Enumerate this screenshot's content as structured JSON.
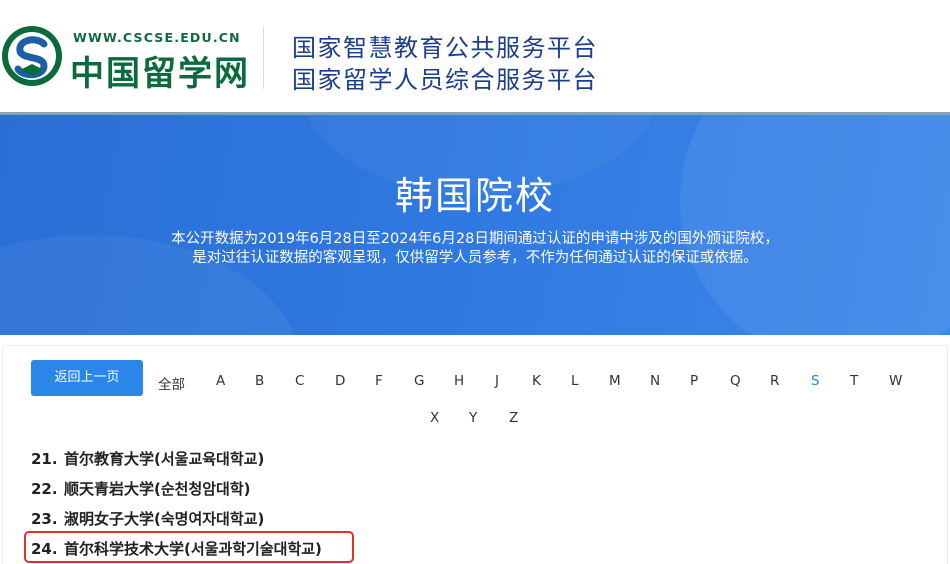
{
  "header": {
    "logo_url": "WWW.CSCSE.EDU.CN",
    "logo_name": "中国留学网",
    "platform_line1": "国家智慧教育公共服务平台",
    "platform_line2": "国家留学人员综合服务平台"
  },
  "banner": {
    "title": "韩国院校",
    "description_line1": "本公开数据为2019年6月28日至2024年6月28日期间通过认证的申请中涉及的国外颁证院校，",
    "description_line2": "是对过往认证数据的客观呈现，仅供留学人员参考，不作为任何通过认证的保证或依据。"
  },
  "filter": {
    "back_label": "返回上一页",
    "all_label": "全部",
    "letters_row1": [
      "A",
      "B",
      "C",
      "D",
      "F",
      "G",
      "H",
      "J",
      "K",
      "L",
      "M",
      "N",
      "P",
      "Q",
      "R",
      "S",
      "T",
      "W"
    ],
    "letters_row2": [
      "X",
      "Y",
      "Z"
    ],
    "active_letter": "S"
  },
  "schools": [
    {
      "num": "21.",
      "name": "首尔教育大学(서울교육대학교)"
    },
    {
      "num": "22.",
      "name": "顺天青岩大学(순천청암대학)"
    },
    {
      "num": "23.",
      "name": "淑明女子大学(숙명여자대학교)"
    },
    {
      "num": "24.",
      "name": "首尔科学技术大学(서울과학기술대학교)"
    }
  ],
  "colors": {
    "accent": "#2a86e8",
    "banner": "#2f78e0",
    "highlight": "#e0312b",
    "logo_green": "#0c6b3d",
    "platform_text": "#1b3f8a"
  }
}
